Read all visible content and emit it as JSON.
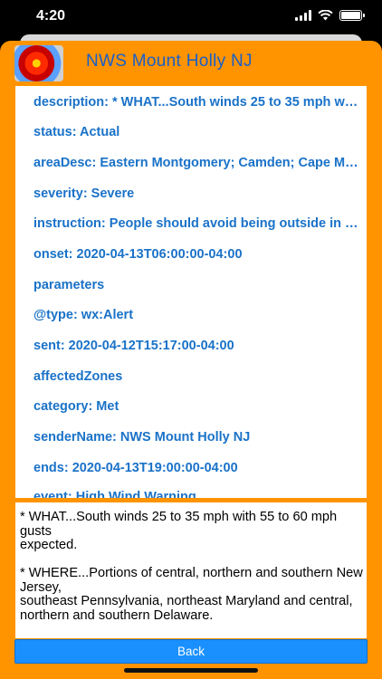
{
  "status_bar": {
    "time": "4:20",
    "battery_level": 1.0
  },
  "header": {
    "title": "NWS Mount Holly NJ",
    "icon": "weather-radar-icon"
  },
  "properties": [
    "description: * WHAT...South winds 25 to 35 mph with 55 to 60 mph gusts expected.",
    "status: Actual",
    "areaDesc: Eastern Montgomery; Camden; Cape May; Sussex; Warren; Morris",
    "severity: Severe",
    "instruction: People should avoid being outside in forested areas",
    "onset: 2020-04-13T06:00:00-04:00",
    "parameters",
    "@type: wx:Alert",
    "sent: 2020-04-12T15:17:00-04:00",
    "affectedZones",
    "category: Met",
    "senderName: NWS Mount Holly NJ",
    "ends: 2020-04-13T19:00:00-04:00",
    "event: High Wind Warning"
  ],
  "detail_text": "* WHAT...South winds 25 to 35 mph with 55 to 60 mph gusts\nexpected.\n\n* WHERE...Portions of central, northern and southern New Jersey,\nsoutheast Pennsylvania, northeast Maryland and central,\nnorthern and southern Delaware.",
  "back_label": "Back"
}
